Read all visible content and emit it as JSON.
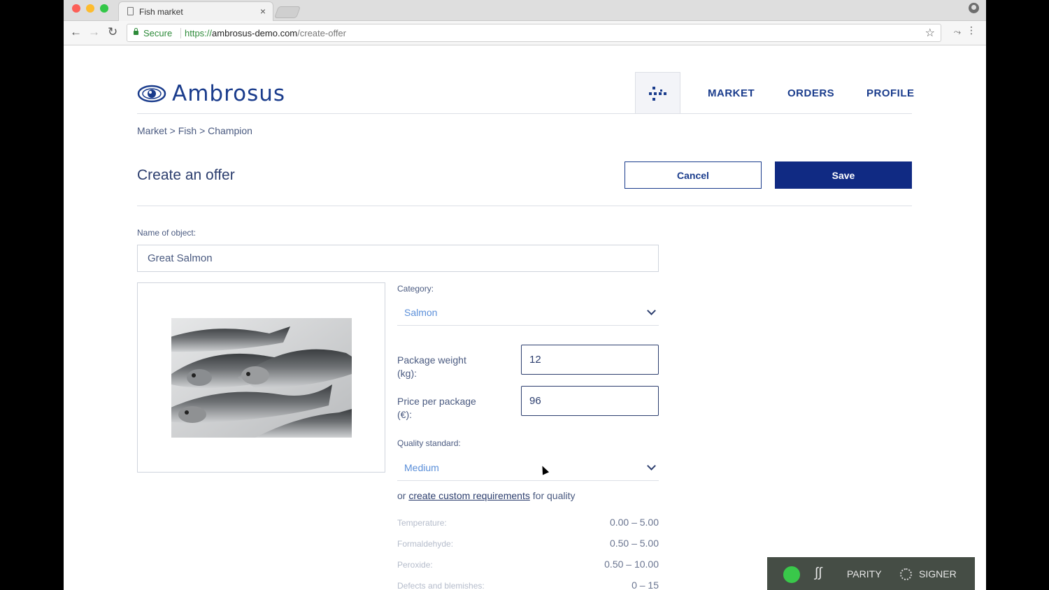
{
  "browser": {
    "tab_title": "Fish market",
    "tab_close": "×",
    "secure_label": "Secure",
    "url_scheme": "https://",
    "url_host": "ambrosus-demo.com",
    "url_path": "/create-offer"
  },
  "header": {
    "logo_text": "Ambrosus",
    "nav": [
      "MARKET",
      "ORDERS",
      "PROFILE"
    ]
  },
  "breadcrumb": "Market > Fish > Champion",
  "page": {
    "title": "Create an offer",
    "cancel_label": "Cancel",
    "save_label": "Save"
  },
  "form": {
    "name_label": "Name of object:",
    "name_value": "Great Salmon",
    "category_label": "Category:",
    "category_value": "Salmon",
    "package_weight_label_1": "Package weight",
    "package_weight_label_2": "(kg):",
    "package_weight_value": "12",
    "price_label_1": "Price per package",
    "price_label_2": "(€):",
    "price_value": "96",
    "quality_label": "Quality standard:",
    "quality_value": "Medium",
    "custom_prefix": "or ",
    "custom_link": "create custom requirements",
    "custom_suffix": " for quality"
  },
  "requirements": [
    {
      "label": "Temperature:",
      "value": "0.00 – 5.00"
    },
    {
      "label": "Formaldehyde:",
      "value": "0.50 – 5.00"
    },
    {
      "label": "Peroxide:",
      "value": "0.50 – 10.00"
    },
    {
      "label": "Defects and blemishes:",
      "value": "0 – 15"
    }
  ],
  "parity": {
    "parity_label": "PARITY",
    "signer_label": "SIGNER"
  },
  "colors": {
    "brand": "#1a3c8c",
    "save_button": "#102a83",
    "select_value": "#5b8fd9"
  }
}
